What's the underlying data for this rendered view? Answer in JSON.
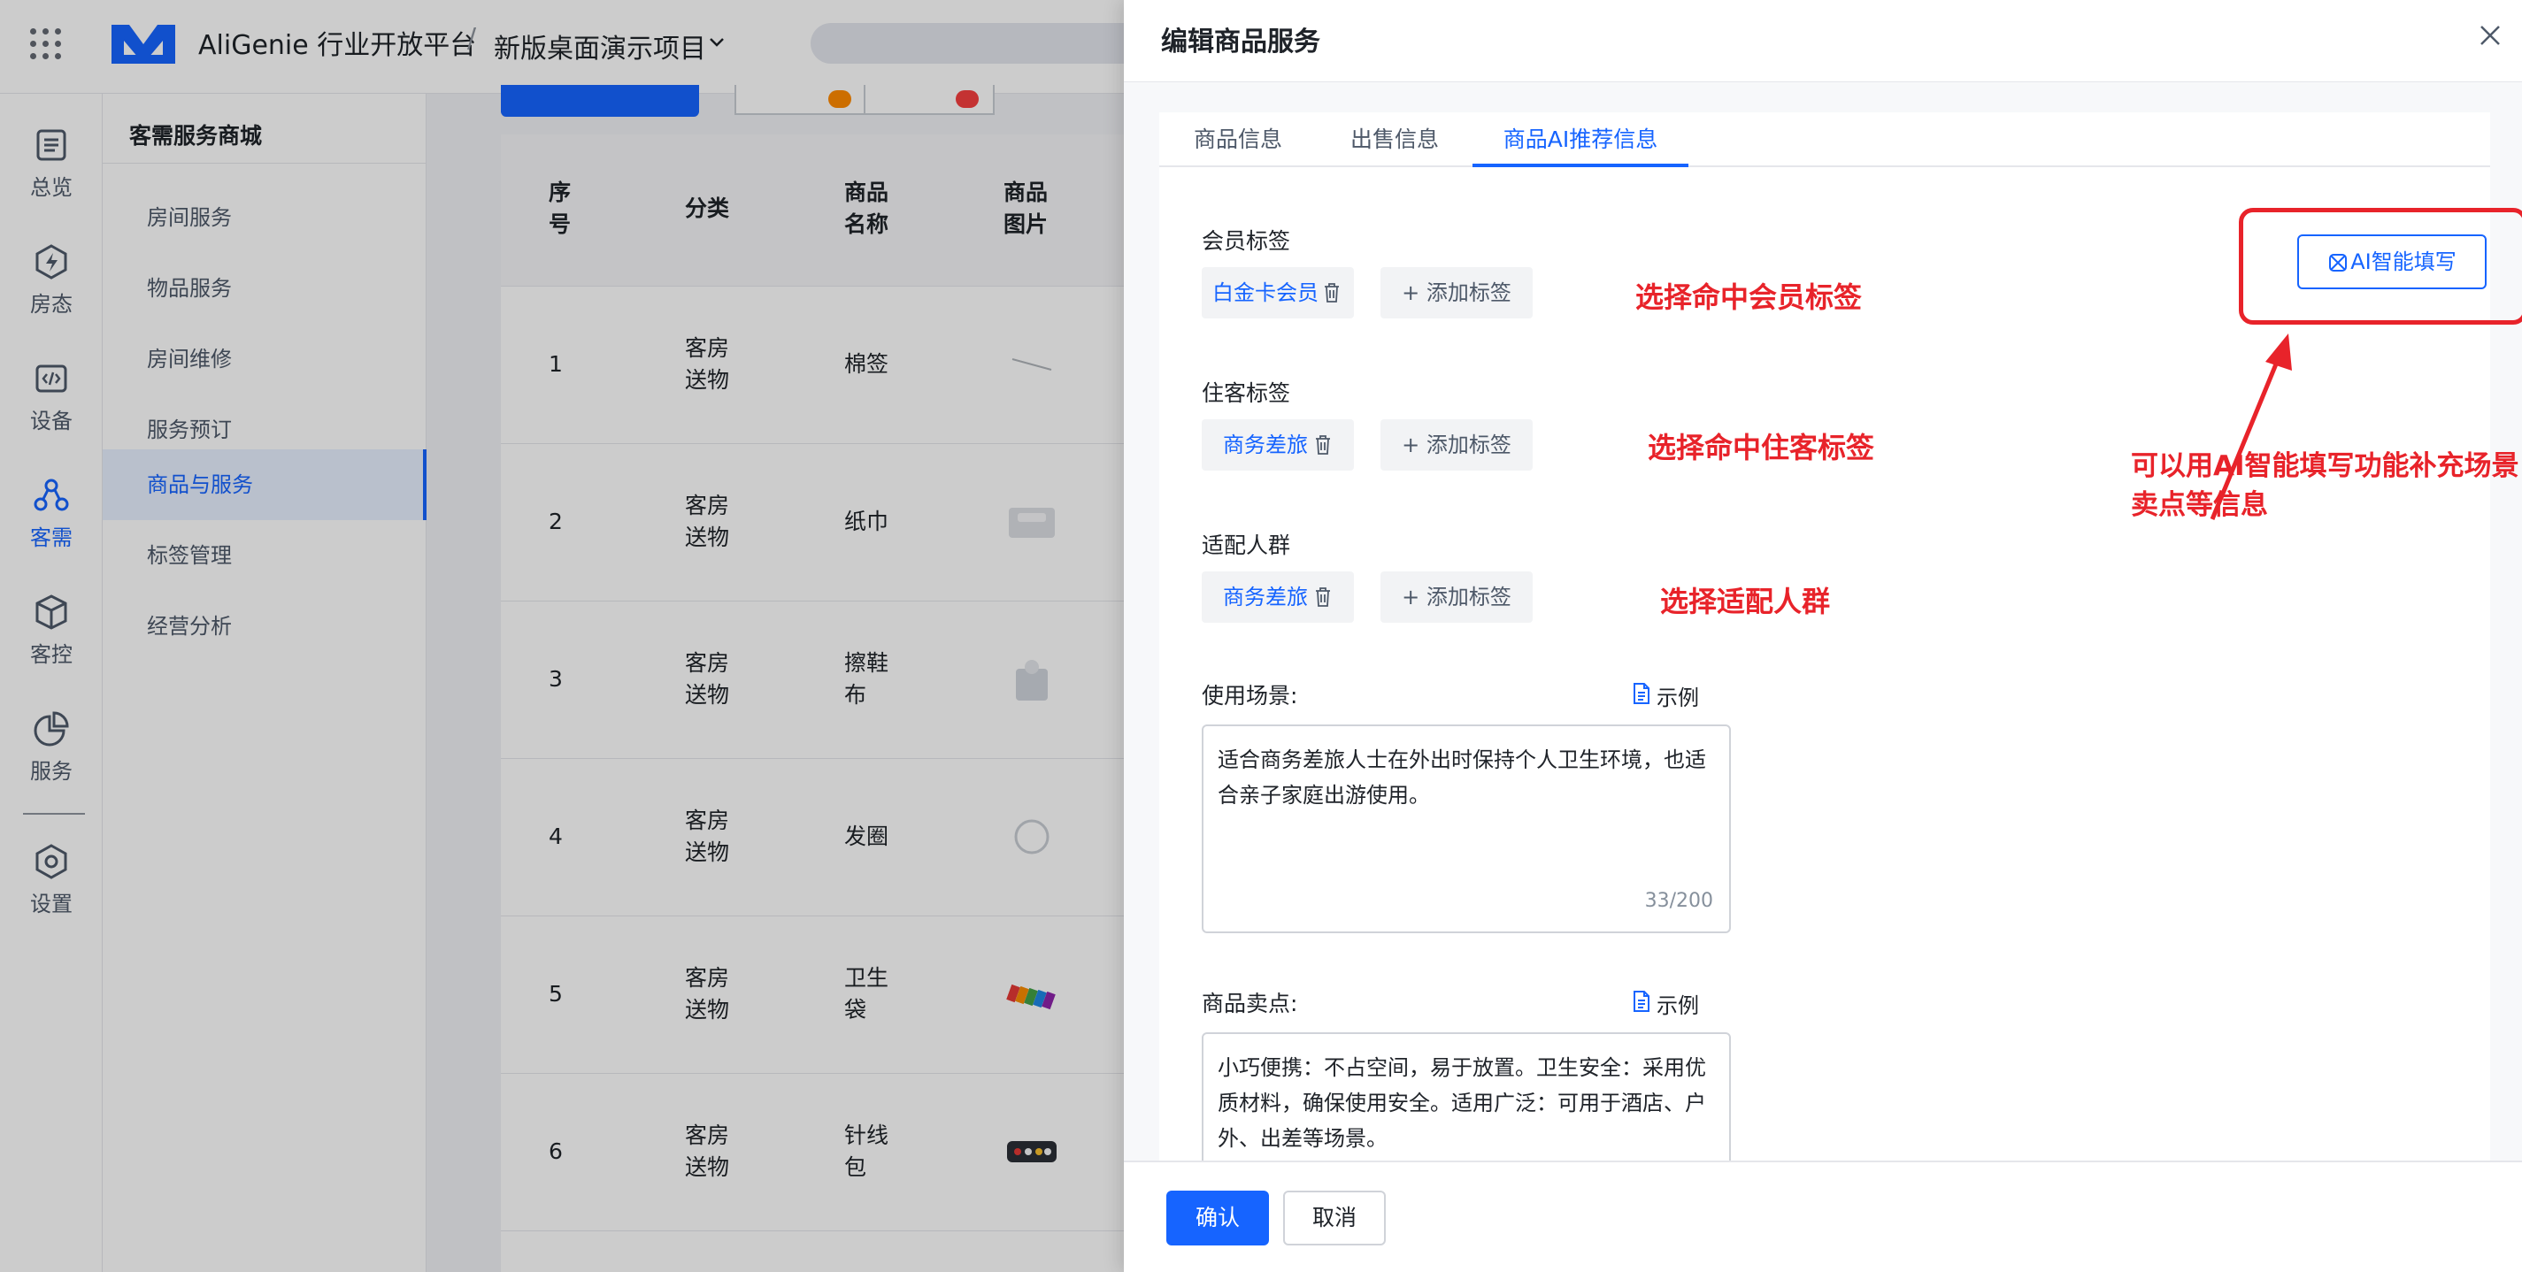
{
  "topbar": {
    "brand": "AliGenie 行业开放平台",
    "separator": "/",
    "project": "新版桌面演示项目"
  },
  "leftnav": {
    "items": [
      {
        "label": "总览",
        "icon": "overview-icon"
      },
      {
        "label": "房态",
        "icon": "room-status-icon"
      },
      {
        "label": "设备",
        "icon": "device-icon"
      },
      {
        "label": "客需",
        "icon": "guest-needs-icon",
        "active": true
      },
      {
        "label": "客控",
        "icon": "guest-control-icon"
      },
      {
        "label": "服务",
        "icon": "service-icon"
      },
      {
        "label": "设置",
        "icon": "settings-icon"
      }
    ]
  },
  "subnav": {
    "title": "客需服务商城",
    "items": [
      {
        "label": "房间服务"
      },
      {
        "label": "物品服务"
      },
      {
        "label": "房间维修"
      },
      {
        "label": "服务预订"
      },
      {
        "label": "商品与服务",
        "active": true
      },
      {
        "label": "标签管理"
      },
      {
        "label": "经营分析"
      }
    ]
  },
  "table": {
    "headers": {
      "index": "序\n号",
      "category": "分类",
      "name": "商品\n名称",
      "image": "商品\n图片"
    },
    "rows": [
      {
        "index": "1",
        "category": "客房\n送物",
        "name": "棉签"
      },
      {
        "index": "2",
        "category": "客房\n送物",
        "name": "纸巾"
      },
      {
        "index": "3",
        "category": "客房\n送物",
        "name": "擦鞋\n布"
      },
      {
        "index": "4",
        "category": "客房\n送物",
        "name": "发圈"
      },
      {
        "index": "5",
        "category": "客房\n送物",
        "name": "卫生\n袋"
      },
      {
        "index": "6",
        "category": "客房\n送物",
        "name": "针线\n包"
      }
    ]
  },
  "drawer": {
    "title": "编辑商品服务",
    "tabs": [
      {
        "label": "商品信息"
      },
      {
        "label": "出售信息"
      },
      {
        "label": "商品AI推荐信息",
        "active": true
      }
    ],
    "ai_button": "AI智能填写",
    "member_tags": {
      "label": "会员标签",
      "tags": [
        "白金卡会员"
      ],
      "add": "+ 添加标签",
      "annotation": "选择命中会员标签"
    },
    "guest_tags": {
      "label": "住客标签",
      "tags": [
        "商务差旅"
      ],
      "add": "+ 添加标签",
      "annotation": "选择命中住客标签"
    },
    "audience": {
      "label": "适配人群",
      "tags": [
        "商务差旅"
      ],
      "add": "+ 添加标签",
      "annotation": "选择适配人群"
    },
    "ai_annotation": "可以用AI智能填写功能补充场景卖点等信息",
    "scenario": {
      "label": "使用场景:",
      "example": "示例",
      "value": "适合商务差旅人士在外出时保持个人卫生环境，也适合亲子家庭出游使用。",
      "counter": "33/200"
    },
    "selling_points": {
      "label": "商品卖点:",
      "example": "示例",
      "value": "小巧便携：不占空间，易于放置。卫生安全：采用优质材料，确保使用安全。适用广泛：可用于酒店、户外、出差等场景。"
    },
    "footer": {
      "confirm": "确认",
      "cancel": "取消"
    }
  },
  "colors": {
    "primary": "#1664ff",
    "annotation": "#e8232a",
    "overlay": "rgba(0,0,0,0.2)"
  }
}
